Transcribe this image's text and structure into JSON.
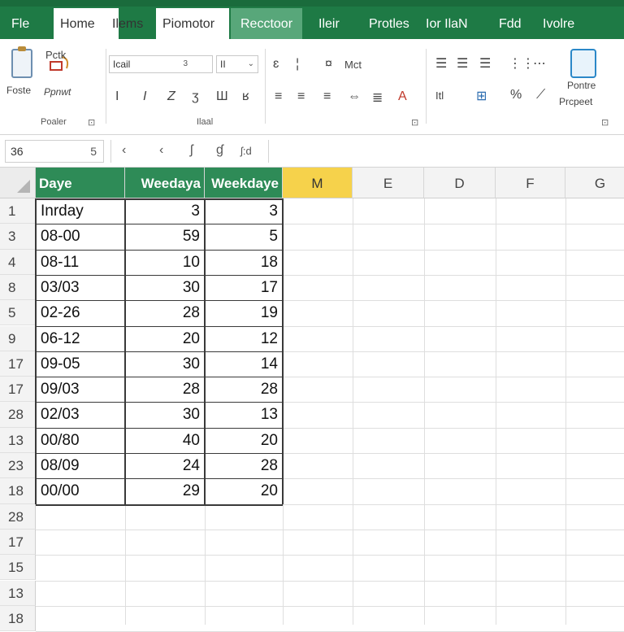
{
  "tabs": {
    "file": "Fle",
    "home": "Home",
    "items": "Ilems",
    "promotor": "Piomotor",
    "active": "Recctoor",
    "view": "Ileir",
    "profiles": "Protles",
    "for_daily": "Ior IlaN",
    "field": "Fdd",
    "help": "Ivolre"
  },
  "ribbon": {
    "clipboard": {
      "paste_label": "Foste",
      "format_painter_label": "Pctk",
      "painter_sub": "Ppnwt",
      "group_label": "Poaler"
    },
    "font": {
      "font_name": "Icail",
      "font_size": "II",
      "group_label": "Ilaal",
      "size_small": "3",
      "bold": "I",
      "italic": "I",
      "underline": "Z",
      "strike": "ʒ",
      "sub": "Ш",
      "fill": "ʁ",
      "misc": "ɪ"
    },
    "align": {
      "wrap": "Mct",
      "label_a": "ɛ",
      "label_b": "¦",
      "nct": "¤"
    },
    "number": {
      "label": "Itl",
      "percent": "%"
    },
    "styles": {
      "label_line1": "Pontre",
      "label_line2": "Prcpeet"
    },
    "dialog_glyph": "⊡"
  },
  "formula_bar": {
    "name_box": "36",
    "name_box_arrow": "5",
    "cancel": "‹",
    "enter": "‹",
    "fx1": "ʃ",
    "fx2": "ɠ",
    "fx3": "ʃ:d"
  },
  "columns": [
    {
      "key": "A",
      "label": "Daye"
    },
    {
      "key": "B",
      "label": "Weedaya"
    },
    {
      "key": "C",
      "label": "Weekdaye"
    },
    {
      "key": "D1",
      "label": "M"
    },
    {
      "key": "E",
      "label": "E"
    },
    {
      "key": "F",
      "label": "D"
    },
    {
      "key": "G",
      "label": "F"
    },
    {
      "key": "H",
      "label": "G"
    }
  ],
  "rows": [
    {
      "num": "1",
      "a": "Inrday",
      "b": "3",
      "c": "3"
    },
    {
      "num": "3",
      "a": "08-00",
      "b": "59",
      "c": "5"
    },
    {
      "num": "4",
      "a": "08-11",
      "b": "10",
      "c": "18"
    },
    {
      "num": "8",
      "a": "03/03",
      "b": "30",
      "c": "17"
    },
    {
      "num": "5",
      "a": "02-26",
      "b": "28",
      "c": "19"
    },
    {
      "num": "9",
      "a": "06-12",
      "b": "20",
      "c": "12"
    },
    {
      "num": "17",
      "a": "09-05",
      "b": "30",
      "c": "14"
    },
    {
      "num": "17",
      "a": "09/03",
      "b": "28",
      "c": "28"
    },
    {
      "num": "28",
      "a": "02/03",
      "b": "30",
      "c": "13"
    },
    {
      "num": "13",
      "a": "00/80",
      "b": "40",
      "c": "20"
    },
    {
      "num": "23",
      "a": "08/09",
      "b": "24",
      "c": "28"
    },
    {
      "num": "18",
      "a": "00/00",
      "b": "29",
      "c": "20"
    },
    {
      "num": "28",
      "a": "",
      "b": "",
      "c": ""
    },
    {
      "num": "17",
      "a": "",
      "b": "",
      "c": ""
    },
    {
      "num": "15",
      "a": "",
      "b": "",
      "c": ""
    },
    {
      "num": "13",
      "a": "",
      "b": "",
      "c": ""
    },
    {
      "num": "18",
      "a": "",
      "b": "",
      "c": ""
    }
  ],
  "colors": {
    "tab_bar": "#1e7a45",
    "header_green": "#2e8b57",
    "selected_col": "#f6d24b"
  }
}
